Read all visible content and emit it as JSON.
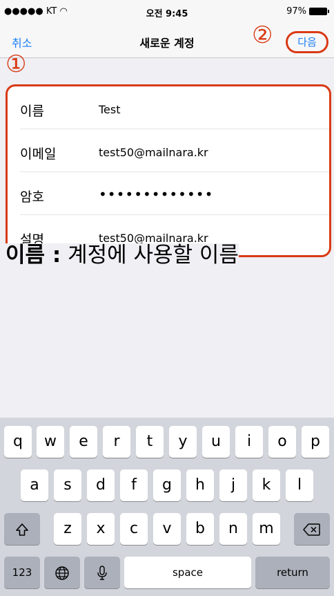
{
  "status_bar": {
    "carrier": "●●●●● KT ",
    "wifi_icon": "wifi-icon",
    "time": "오전 9:45",
    "battery": "97%"
  },
  "nav": {
    "cancel": "취소",
    "title": "새로운 계정",
    "next": "다음"
  },
  "annotations": {
    "step1": "①",
    "step2": "②",
    "accent_color": "#d93a14"
  },
  "form": [
    {
      "label": "이름",
      "value": "Test"
    },
    {
      "label": "이메일",
      "value": "test50@mailnara.kr"
    },
    {
      "label": "암호",
      "value": "•••••••••••••"
    },
    {
      "label": "설명",
      "value": "test50@mailnara.kr"
    }
  ],
  "caption": {
    "strong": "이름 :",
    "rest": " 계정에 사용할 이름"
  },
  "keyboard": {
    "row1": [
      "q",
      "w",
      "e",
      "r",
      "t",
      "y",
      "u",
      "i",
      "o",
      "p"
    ],
    "row2": [
      "a",
      "s",
      "d",
      "f",
      "g",
      "h",
      "j",
      "k",
      "l"
    ],
    "row3": [
      "z",
      "x",
      "c",
      "v",
      "b",
      "n",
      "m"
    ],
    "numbers": "123",
    "space": "space",
    "return": "return",
    "shift_icon": "shift-icon",
    "delete_icon": "delete-icon",
    "globe_icon": "globe-icon",
    "mic_icon": "microphone-icon"
  }
}
